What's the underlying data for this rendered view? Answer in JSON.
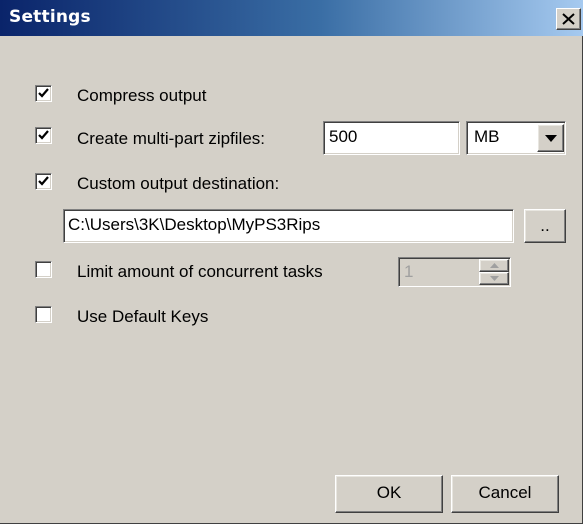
{
  "window": {
    "title": "Settings"
  },
  "options": {
    "compress": {
      "label": "Compress output",
      "checked": true
    },
    "multipart": {
      "label": "Create multi-part zipfiles:",
      "checked": true,
      "size_value": "500",
      "unit_selected": "MB"
    },
    "custom_dest": {
      "label": "Custom output destination:",
      "checked": true,
      "path_value": "C:\\Users\\3K\\Desktop\\MyPS3Rips",
      "browse_label": ".."
    },
    "limit_tasks": {
      "label": "Limit amount of concurrent tasks",
      "checked": false,
      "count_value": "1"
    },
    "default_keys": {
      "label": "Use Default Keys",
      "checked": false
    }
  },
  "buttons": {
    "ok": "OK",
    "cancel": "Cancel"
  }
}
